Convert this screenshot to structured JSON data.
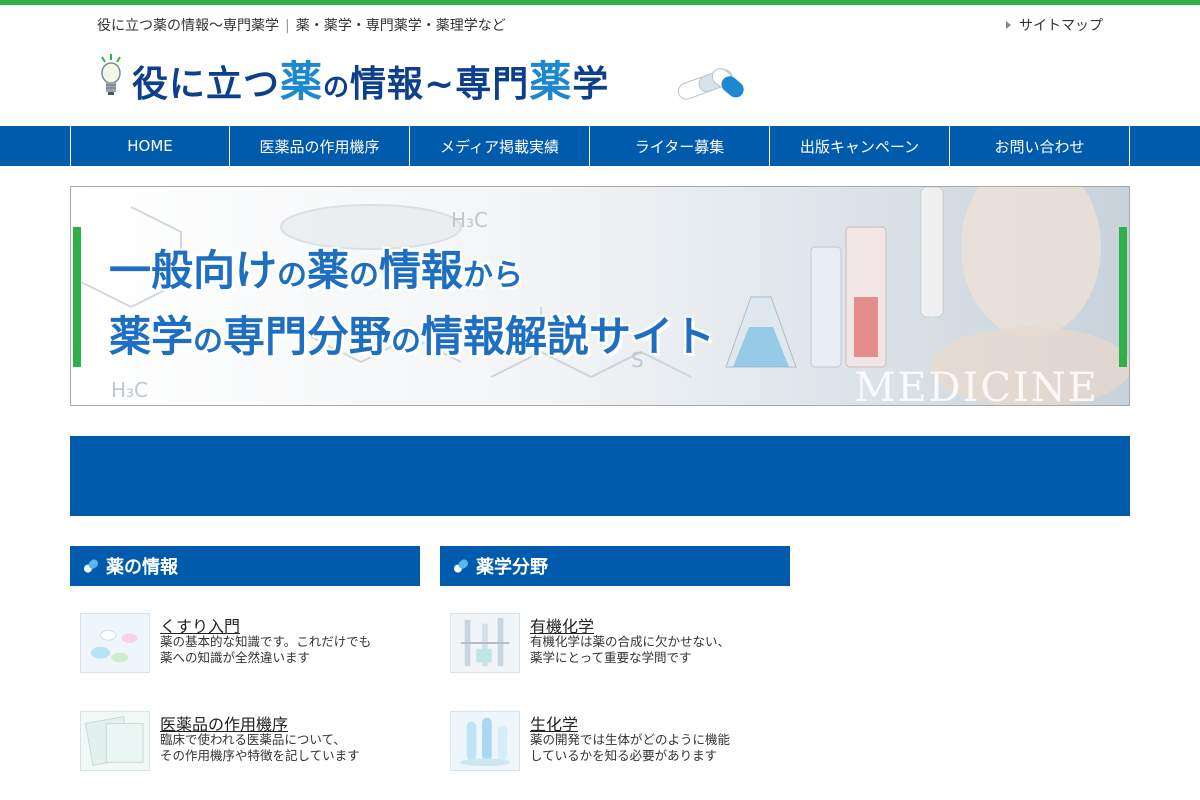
{
  "header": {
    "tagline_site": "役に立つ薬の情報〜専門薬学",
    "tagline_sep": "|",
    "tagline_topics": "薬・薬学・専門薬学・薬理学など",
    "sitemap": "サイトマップ",
    "logo_part1": "役に立つ",
    "logo_big1": "薬",
    "logo_part2": "の",
    "logo_part3": "情報~専門",
    "logo_big2": "薬",
    "logo_part4": "学"
  },
  "nav": [
    {
      "label": "HOME"
    },
    {
      "label": "医薬品の作用機序"
    },
    {
      "label": "メディア掲載実績"
    },
    {
      "label": "ライター募集"
    },
    {
      "label": "出版キャンペーン"
    },
    {
      "label": "お問い合わせ"
    }
  ],
  "hero": {
    "line1_a": "一般向け",
    "line1_b": "の",
    "line1_c": "薬",
    "line1_d": "の",
    "line1_e": "情報",
    "line1_f": "から",
    "line2_a": "薬学",
    "line2_b": "の",
    "line2_c": "専門分野",
    "line2_d": "の",
    "line2_e": "情報解説サイト",
    "watermark": "MEDICINE"
  },
  "sections": [
    {
      "heading": "薬の情報",
      "items": [
        {
          "title": "くすり入門",
          "desc1": "薬の基本的な知識です。これだけでも",
          "desc2": "薬への知識が全然違います"
        },
        {
          "title": "医薬品の作用機序",
          "desc1": "臨床で使われる医薬品について、",
          "desc2": "その作用機序や特徴を記しています"
        }
      ]
    },
    {
      "heading": "薬学分野",
      "items": [
        {
          "title": "有機化学",
          "desc1": "有機化学は薬の合成に欠かせない、",
          "desc2": "薬学にとって重要な学問です"
        },
        {
          "title": "生化学",
          "desc1": "薬の開発では生体がどのように機能",
          "desc2": "しているかを知る必要があります"
        }
      ]
    }
  ],
  "colors": {
    "nav_blue": "#005bac",
    "accent_green": "#2fb14a",
    "logo_navy": "#0d3f8a",
    "logo_light_blue": "#1d87cf"
  }
}
